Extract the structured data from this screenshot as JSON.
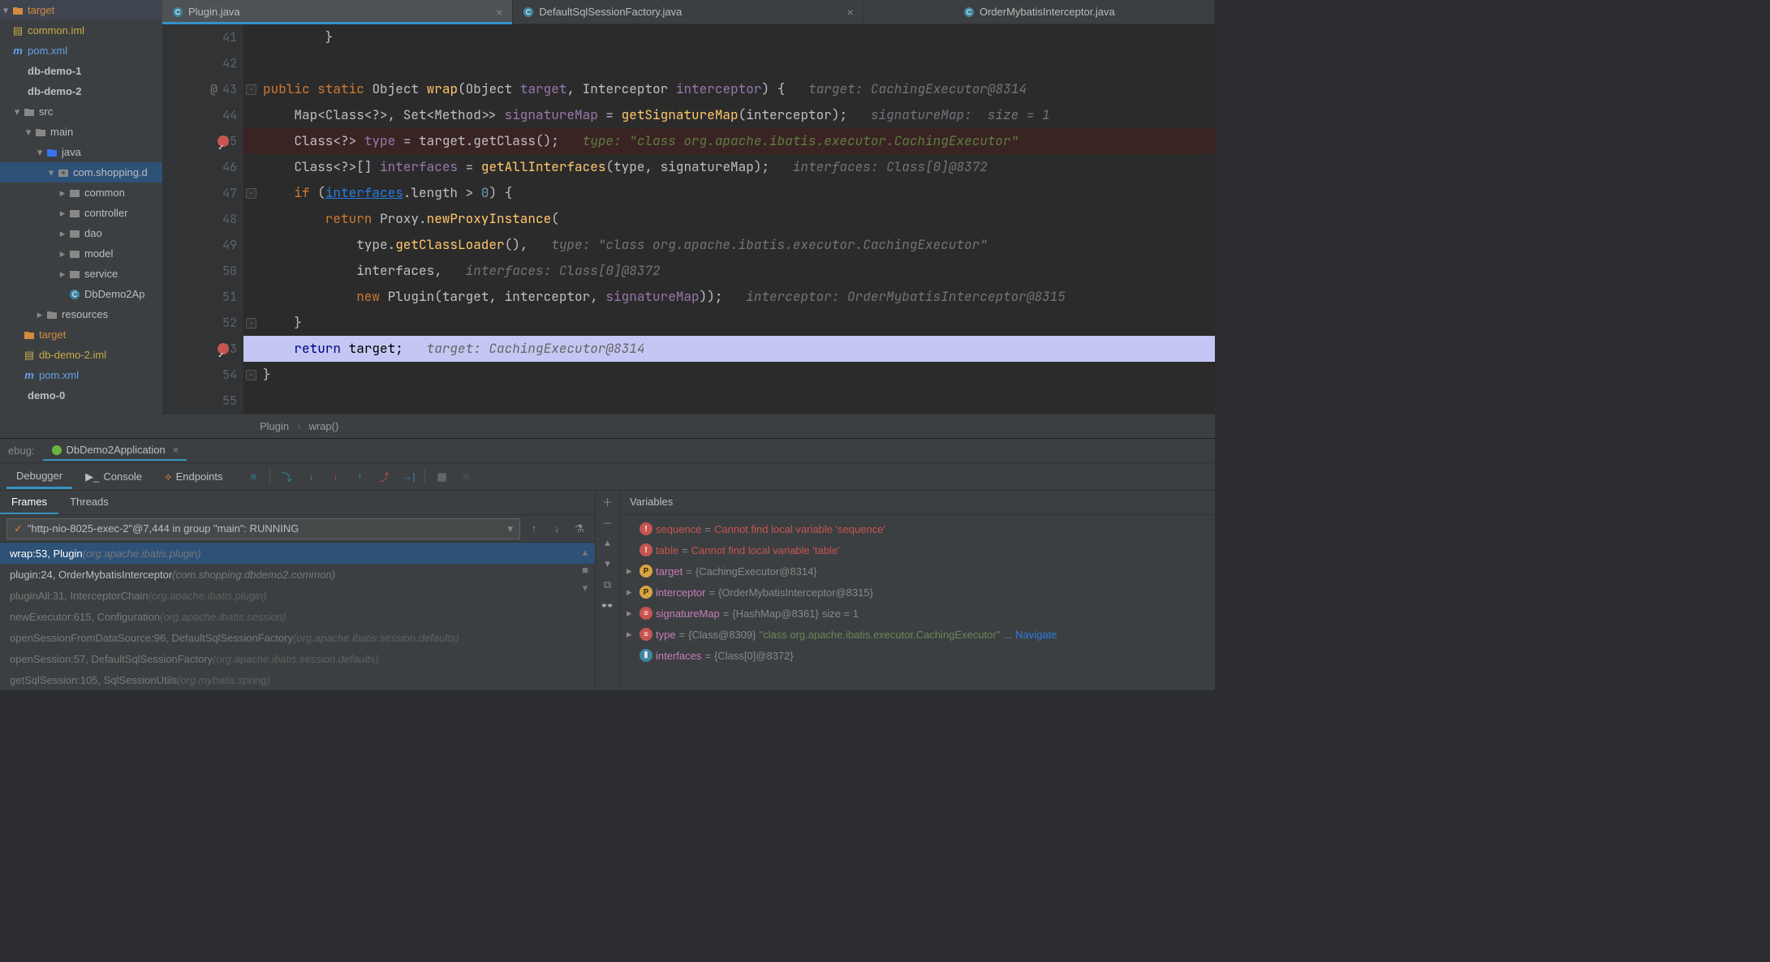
{
  "tabs": [
    {
      "label": "Plugin.java",
      "icon": "java-class-icon",
      "active": true,
      "closable": true
    },
    {
      "label": "DefaultSqlSessionFactory.java",
      "icon": "java-class-icon",
      "active": false,
      "closable": true
    },
    {
      "label": "OrderMybatisInterceptor.java",
      "icon": "java-class-icon",
      "active": false,
      "closable": false
    }
  ],
  "project": [
    {
      "label": "target",
      "indent": 0,
      "arrow": "▾",
      "icon": "folder-orange-icon",
      "color": "#d28b40"
    },
    {
      "label": "common.iml",
      "indent": 0,
      "arrow": "",
      "icon": "iml-file-icon",
      "color": "#c9a94a"
    },
    {
      "label": "pom.xml",
      "indent": 0,
      "arrow": "",
      "icon": "maven-file-icon",
      "color": "#62a0ea"
    },
    {
      "label": "db-demo-1",
      "indent": 0,
      "arrow": "",
      "icon": "module-icon",
      "color": "#bbb"
    },
    {
      "label": "db-demo-2",
      "indent": 0,
      "arrow": "",
      "icon": "module-icon",
      "color": "#bbb"
    },
    {
      "label": "src",
      "indent": 1,
      "arrow": "▾",
      "icon": "folder-icon",
      "color": "#888"
    },
    {
      "label": "main",
      "indent": 2,
      "arrow": "▾",
      "icon": "folder-icon",
      "color": "#888"
    },
    {
      "label": "java",
      "indent": 3,
      "arrow": "▾",
      "icon": "folder-blue-icon",
      "color": "#3574f0"
    },
    {
      "label": "com.shopping.d",
      "indent": 4,
      "arrow": "▾",
      "icon": "package-icon",
      "color": "#888",
      "selected": true
    },
    {
      "label": "common",
      "indent": 5,
      "arrow": "▸",
      "icon": "package-icon",
      "color": "#888"
    },
    {
      "label": "controller",
      "indent": 5,
      "arrow": "▸",
      "icon": "package-icon",
      "color": "#888"
    },
    {
      "label": "dao",
      "indent": 5,
      "arrow": "▸",
      "icon": "package-icon",
      "color": "#888"
    },
    {
      "label": "model",
      "indent": 5,
      "arrow": "▸",
      "icon": "package-icon",
      "color": "#888"
    },
    {
      "label": "service",
      "indent": 5,
      "arrow": "▸",
      "icon": "package-icon",
      "color": "#888"
    },
    {
      "label": "DbDemo2Ap",
      "indent": 5,
      "arrow": "",
      "icon": "spring-app-icon",
      "color": "#6db33f"
    },
    {
      "label": "resources",
      "indent": 3,
      "arrow": "▸",
      "icon": "folder-res-icon",
      "color": "#888"
    },
    {
      "label": "target",
      "indent": 1,
      "arrow": "",
      "icon": "folder-orange-icon",
      "color": "#d28b40"
    },
    {
      "label": "db-demo-2.iml",
      "indent": 1,
      "arrow": "",
      "icon": "iml-file-icon",
      "color": "#c9a94a"
    },
    {
      "label": "pom.xml",
      "indent": 1,
      "arrow": "",
      "icon": "maven-file-icon",
      "color": "#62a0ea"
    },
    {
      "label": "demo-0",
      "indent": 0,
      "arrow": "",
      "icon": "module-icon",
      "color": "#bbb"
    }
  ],
  "gutter": [
    "41",
    "42",
    "43",
    "44",
    "45",
    "46",
    "47",
    "48",
    "49",
    "50",
    "51",
    "52",
    "53",
    "54",
    "55"
  ],
  "gutter_anno_line": "43",
  "gutter_anno_symbol": "@",
  "gutter_bp": [
    "45",
    "53"
  ],
  "code": {
    "l41": "        }",
    "l43a": "public",
    "l43b": "static",
    "l43c": "Object ",
    "l43d": "wrap",
    "l43e": "(Object ",
    "l43f": "target",
    "l43g": ", Interceptor ",
    "l43h": "interceptor",
    "l43i": ") {",
    "l43hint": "   target: CachingExecutor@8314",
    "l44a": "    Map<Class<?>, Set<Method>> ",
    "l44b": "signatureMap",
    "l44c": " = ",
    "l44d": "getSignatureMap",
    "l44e": "(interceptor);",
    "l44hint": "   signatureMap:  size = 1",
    "l45a": "    Class<?> ",
    "l45b": "type",
    "l45c": " = target.getClass();",
    "l45hint": "   type: \"class org.apache.ibatis.executor.CachingExecutor\"",
    "l46a": "    Class<?>[] ",
    "l46b": "interfaces",
    "l46c": " = ",
    "l46d": "getAllInterfaces",
    "l46e": "(type, signatureMap);",
    "l46hint": "   interfaces: Class[0]@8372",
    "l47a": "    if",
    "l47b": " (",
    "l47c": "interfaces",
    "l47d": ".length > ",
    "l47e": "0",
    "l47f": ") {",
    "l48a": "        return",
    "l48b": " Proxy.",
    "l48c": "newProxyInstance",
    "l48d": "(",
    "l49a": "            type.",
    "l49b": "getClassLoader",
    "l49c": "(),",
    "l49hint": "   type: \"class org.apache.ibatis.executor.CachingExecutor\"",
    "l50a": "            interfaces,",
    "l50hint": "   interfaces: Class[0]@8372",
    "l51a": "            new",
    "l51b": " Plugin(target, interceptor, ",
    "l51c": "signatureMap",
    "l51d": "));",
    "l51hint": "   interceptor: OrderMybatisInterceptor@8315",
    "l52a": "    }",
    "l53a": "    return",
    "l53b": " target;",
    "l53hint": "   target: CachingExecutor@8314",
    "l54a": "}"
  },
  "breadcrumb": {
    "a": "Plugin",
    "sep": "›",
    "b": "wrap()"
  },
  "debug": {
    "label": "ebug:",
    "run_tab": "DbDemo2Application",
    "view_tabs": {
      "debugger": "Debugger",
      "console": "Console",
      "endpoints": "Endpoints"
    },
    "frames_tabs": {
      "frames": "Frames",
      "threads": "Threads"
    },
    "thread": "\"http-nio-8025-exec-2\"@7,444 in group \"main\": RUNNING",
    "frames": [
      {
        "sel": true,
        "t": "wrap:53, Plugin ",
        "p": "(org.apache.ibatis.plugin)"
      },
      {
        "sel": false,
        "t": "plugin:24, OrderMybatisInterceptor ",
        "p": "(com.shopping.dbdemo2.common)"
      },
      {
        "sel": false,
        "dim": true,
        "t": "pluginAll:31, InterceptorChain ",
        "p": "(org.apache.ibatis.plugin)"
      },
      {
        "sel": false,
        "dim": true,
        "t": "newExecutor:615, Configuration ",
        "p": "(org.apache.ibatis.session)"
      },
      {
        "sel": false,
        "dim": true,
        "t": "openSessionFromDataSource:96, DefaultSqlSessionFactory ",
        "p": "(org.apache.ibatis.session.defaults)"
      },
      {
        "sel": false,
        "dim": true,
        "t": "openSession:57, DefaultSqlSessionFactory ",
        "p": "(org.apache.ibatis.session.defaults)"
      },
      {
        "sel": false,
        "dim": true,
        "t": "getSqlSession:105, SqlSessionUtils ",
        "p": "(org.mybatis.spring)"
      }
    ],
    "vars_title": "Variables",
    "vars": [
      {
        "kind": "err",
        "name": "sequence",
        "eq": " = ",
        "val": "Cannot find local variable 'sequence'"
      },
      {
        "kind": "err",
        "name": "table",
        "eq": " = ",
        "val": "Cannot find local variable 'table'"
      },
      {
        "kind": "p",
        "arrow": "▸",
        "name": "target",
        "eq": " = ",
        "val": "{CachingExecutor@8314}"
      },
      {
        "kind": "p",
        "arrow": "▸",
        "name": "interceptor",
        "eq": " = ",
        "val": "{OrderMybatisInterceptor@8315}"
      },
      {
        "kind": "f",
        "arrow": "▸",
        "name": "signatureMap",
        "eq": " = ",
        "val": "{HashMap@8361}",
        "extra": "  size = 1"
      },
      {
        "kind": "f",
        "arrow": "▸",
        "name": "type",
        "eq": " = ",
        "val": "{Class@8309}",
        "str": " \"class org.apache.ibatis.executor.CachingExecutor\"",
        "trail": " ... ",
        "lnk": "Navigate"
      },
      {
        "kind": "arr",
        "arrow": "",
        "name": "interfaces",
        "eq": " = ",
        "val": "{Class[0]@8372}"
      }
    ]
  }
}
